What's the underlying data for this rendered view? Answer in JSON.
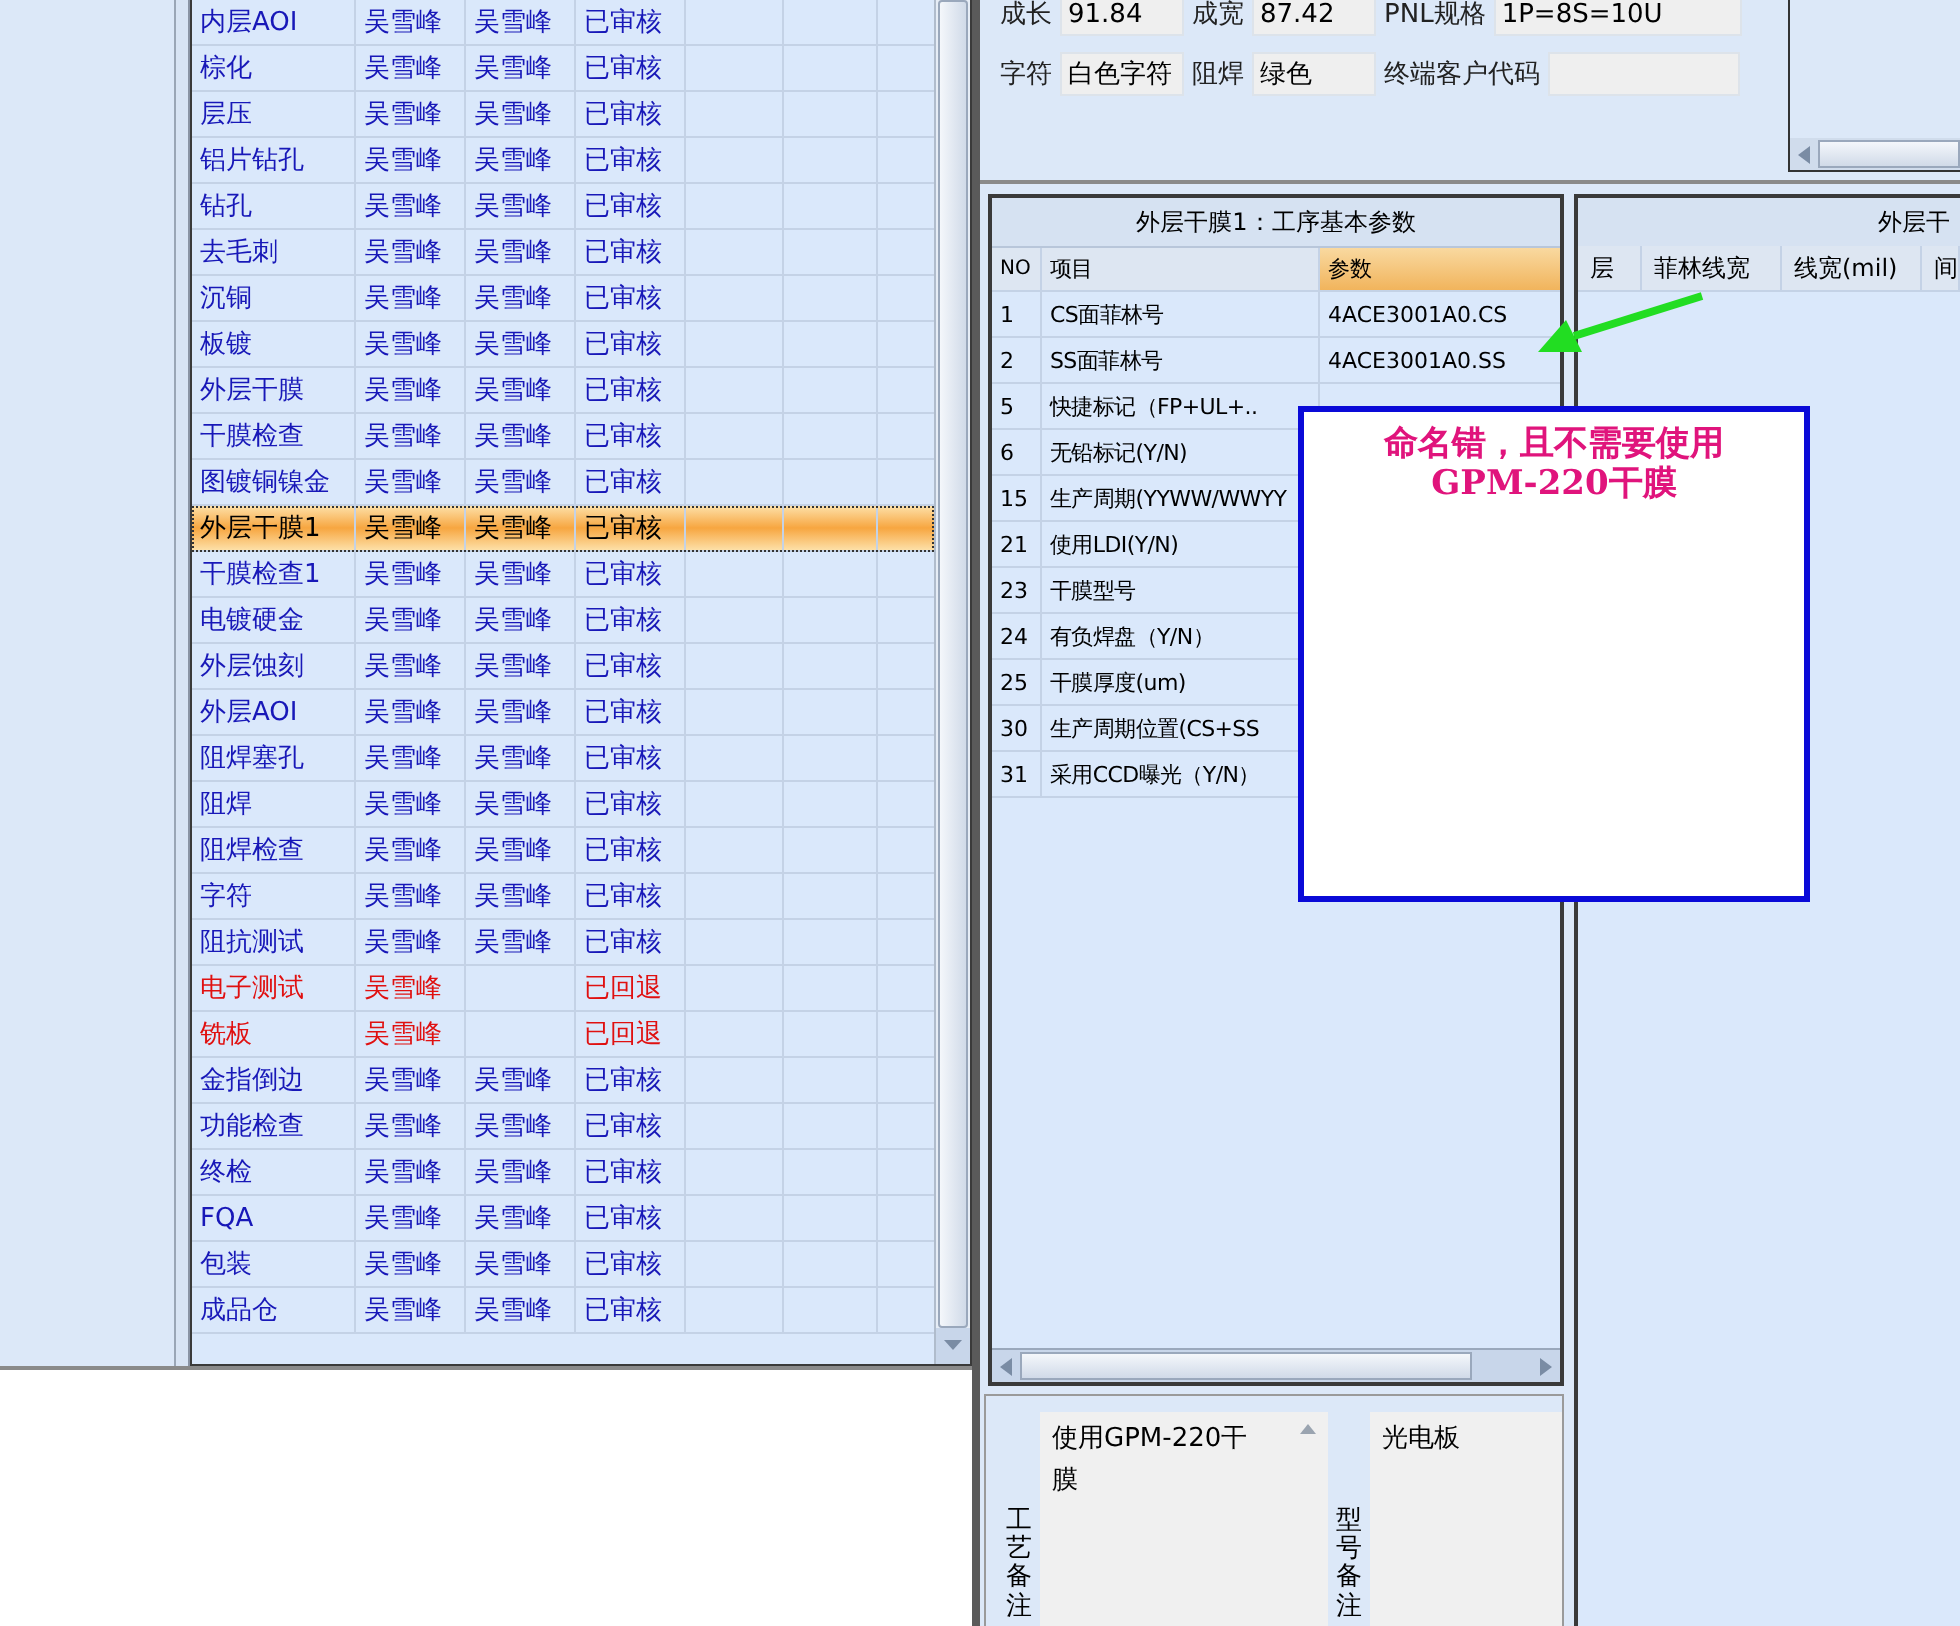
{
  "process_table": {
    "rows": [
      {
        "step": "内层AOI",
        "col_2": "吴雪峰",
        "col_3": "吴雪峰",
        "status": "已审核",
        "returned": false,
        "selected": false
      },
      {
        "step": "棕化",
        "col_2": "吴雪峰",
        "col_3": "吴雪峰",
        "status": "已审核",
        "returned": false,
        "selected": false
      },
      {
        "step": "层压",
        "col_2": "吴雪峰",
        "col_3": "吴雪峰",
        "status": "已审核",
        "returned": false,
        "selected": false
      },
      {
        "step": "铝片钻孔",
        "col_2": "吴雪峰",
        "col_3": "吴雪峰",
        "status": "已审核",
        "returned": false,
        "selected": false
      },
      {
        "step": "钻孔",
        "col_2": "吴雪峰",
        "col_3": "吴雪峰",
        "status": "已审核",
        "returned": false,
        "selected": false
      },
      {
        "step": "去毛刺",
        "col_2": "吴雪峰",
        "col_3": "吴雪峰",
        "status": "已审核",
        "returned": false,
        "selected": false
      },
      {
        "step": "沉铜",
        "col_2": "吴雪峰",
        "col_3": "吴雪峰",
        "status": "已审核",
        "returned": false,
        "selected": false
      },
      {
        "step": "板镀",
        "col_2": "吴雪峰",
        "col_3": "吴雪峰",
        "status": "已审核",
        "returned": false,
        "selected": false
      },
      {
        "step": "外层干膜",
        "col_2": "吴雪峰",
        "col_3": "吴雪峰",
        "status": "已审核",
        "returned": false,
        "selected": false
      },
      {
        "step": "干膜检查",
        "col_2": "吴雪峰",
        "col_3": "吴雪峰",
        "status": "已审核",
        "returned": false,
        "selected": false
      },
      {
        "step": "图镀铜镍金",
        "col_2": "吴雪峰",
        "col_3": "吴雪峰",
        "status": "已审核",
        "returned": false,
        "selected": false
      },
      {
        "step": "外层干膜1",
        "col_2": "吴雪峰",
        "col_3": "吴雪峰",
        "status": "已审核",
        "returned": false,
        "selected": true
      },
      {
        "step": "干膜检查1",
        "col_2": "吴雪峰",
        "col_3": "吴雪峰",
        "status": "已审核",
        "returned": false,
        "selected": false
      },
      {
        "step": "电镀硬金",
        "col_2": "吴雪峰",
        "col_3": "吴雪峰",
        "status": "已审核",
        "returned": false,
        "selected": false
      },
      {
        "step": "外层蚀刻",
        "col_2": "吴雪峰",
        "col_3": "吴雪峰",
        "status": "已审核",
        "returned": false,
        "selected": false
      },
      {
        "step": "外层AOI",
        "col_2": "吴雪峰",
        "col_3": "吴雪峰",
        "status": "已审核",
        "returned": false,
        "selected": false
      },
      {
        "step": "阻焊塞孔",
        "col_2": "吴雪峰",
        "col_3": "吴雪峰",
        "status": "已审核",
        "returned": false,
        "selected": false
      },
      {
        "step": "阻焊",
        "col_2": "吴雪峰",
        "col_3": "吴雪峰",
        "status": "已审核",
        "returned": false,
        "selected": false
      },
      {
        "step": "阻焊检查",
        "col_2": "吴雪峰",
        "col_3": "吴雪峰",
        "status": "已审核",
        "returned": false,
        "selected": false
      },
      {
        "step": "字符",
        "col_2": "吴雪峰",
        "col_3": "吴雪峰",
        "status": "已审核",
        "returned": false,
        "selected": false
      },
      {
        "step": "阻抗测试",
        "col_2": "吴雪峰",
        "col_3": "吴雪峰",
        "status": "已审核",
        "returned": false,
        "selected": false
      },
      {
        "step": "电子测试",
        "col_2": "吴雪峰",
        "status": "已回退",
        "returned": true,
        "selected": false
      },
      {
        "step": "铣板",
        "col_2": "吴雪峰",
        "status": "已回退",
        "returned": true,
        "selected": false
      },
      {
        "step": "金指倒边",
        "col_2": "吴雪峰",
        "col_3": "吴雪峰",
        "status": "已审核",
        "returned": false,
        "selected": false
      },
      {
        "step": "功能检查",
        "col_2": "吴雪峰",
        "col_3": "吴雪峰",
        "status": "已审核",
        "returned": false,
        "selected": false
      },
      {
        "step": "终检",
        "col_2": "吴雪峰",
        "col_3": "吴雪峰",
        "status": "已审核",
        "returned": false,
        "selected": false
      },
      {
        "step": "FQA",
        "col_2": "吴雪峰",
        "col_3": "吴雪峰",
        "status": "已审核",
        "returned": false,
        "selected": false
      },
      {
        "step": "包装",
        "col_2": "吴雪峰",
        "col_3": "吴雪峰",
        "status": "已审核",
        "returned": false,
        "selected": false
      },
      {
        "step": "成品仓",
        "col_2": "吴雪峰",
        "col_3": "吴雪峰",
        "status": "已审核",
        "returned": false,
        "selected": false
      }
    ]
  },
  "board_info": {
    "rows": [
      [
        {
          "label": "成长",
          "value": "91.84"
        },
        {
          "label": "成宽",
          "value": "87.42"
        },
        {
          "label": "PNL规格",
          "value": "1P=8S=10U"
        }
      ],
      [
        {
          "label": "字符",
          "value": "白色字符"
        },
        {
          "label": "阻焊",
          "value": "绿色"
        },
        {
          "label": "终端客户代码"
        }
      ]
    ]
  },
  "params_panel": {
    "title": "外层干膜1：工序基本参数",
    "columns": [
      "NO",
      "项目",
      "参数"
    ],
    "rows": [
      {
        "no": "1",
        "item": "CS面菲林号",
        "value": "4ACE3001A0.CS"
      },
      {
        "no": "2",
        "item": "SS面菲林号",
        "value": "4ACE3001A0.SS"
      },
      {
        "no": "5",
        "item": "快捷标记（FP+UL+.."
      },
      {
        "no": "6",
        "item": "无铅标记(Y/N)"
      },
      {
        "no": "15",
        "item": "生产周期(YYWW/WWYY"
      },
      {
        "no": "21",
        "item": "使用LDI(Y/N)"
      },
      {
        "no": "23",
        "item": "干膜型号"
      },
      {
        "no": "24",
        "item": "有负焊盘（Y/N）"
      },
      {
        "no": "25",
        "item": "干膜厚度(um)"
      },
      {
        "no": "30",
        "item": "生产周期位置(CS+SS"
      },
      {
        "no": "31",
        "item": "采用CCD曝光（Y/N）"
      }
    ]
  },
  "line_panel": {
    "title": "外层干",
    "columns": [
      "层",
      "菲林线宽",
      "线宽(mil)",
      "间"
    ]
  },
  "remarks": [
    {
      "label": "工艺备注",
      "text": "使用GPM-220干膜"
    },
    {
      "label": "型号备注",
      "text": "光电板"
    }
  ],
  "annotation": {
    "text": "命名错，且不需要使用GPM-220干膜"
  }
}
